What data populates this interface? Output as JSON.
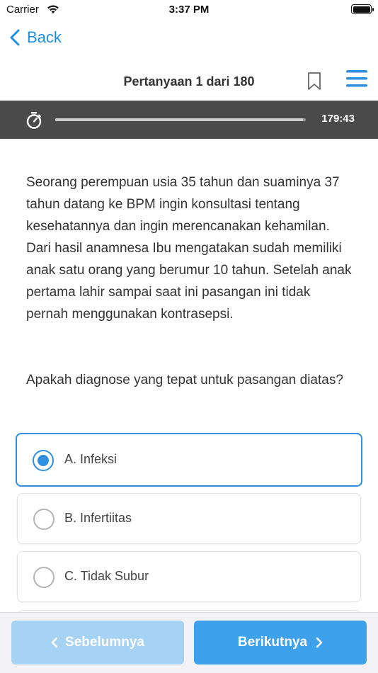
{
  "status_bar": {
    "carrier": "Carrier",
    "time": "3:37 PM"
  },
  "nav": {
    "back_label": "Back"
  },
  "header": {
    "question_counter": "Pertanyaan 1 dari 180"
  },
  "timer": {
    "remaining": "179:43",
    "progress_fraction": 0.99
  },
  "question": {
    "text": "Seorang perempuan usia 35 tahun dan suaminya 37 tahun datang ke BPM ingin konsultasi tentang kesehatannya dan ingin merencanakan kehamilan. Dari hasil anamnesa Ibu mengatakan sudah memiliki anak satu orang yang berumur 10 tahun. Setelah anak pertama lahir sampai saat ini pasangan ini tidak pernah menggunakan kontrasepsi.",
    "prompt": "Apakah diagnose yang tepat untuk pasangan diatas?"
  },
  "options": [
    {
      "label": "A. Infeksi",
      "selected": true
    },
    {
      "label": "B. Infertiitas",
      "selected": false
    },
    {
      "label": "C. Tidak Subur",
      "selected": false
    }
  ],
  "footer": {
    "prev_label": "Sebelumnya",
    "next_label": "Berikutnya"
  },
  "colors": {
    "accent": "#2f8fe0",
    "prev_button": "#a6d2f3",
    "next_button": "#3da2eb",
    "timer_bar": "#4a4a4a"
  },
  "icons": [
    "wifi-icon",
    "battery-icon",
    "back-chevron-icon",
    "bookmark-icon",
    "menu-icon",
    "stopwatch-icon",
    "chevron-left-icon",
    "chevron-right-icon"
  ]
}
